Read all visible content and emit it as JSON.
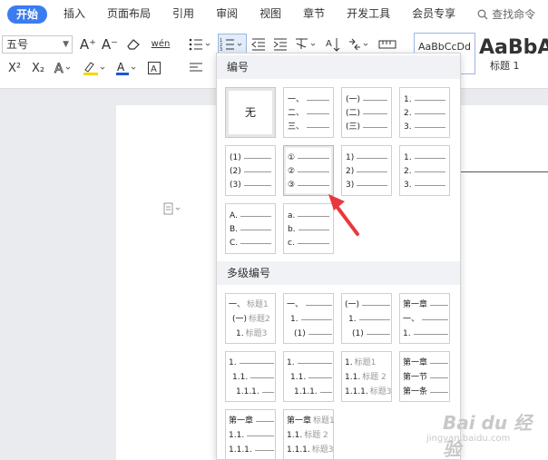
{
  "tabs": [
    {
      "label": "开始",
      "active": true
    },
    {
      "label": "插入",
      "active": false
    },
    {
      "label": "页面布局",
      "active": false
    },
    {
      "label": "引用",
      "active": false
    },
    {
      "label": "审阅",
      "active": false
    },
    {
      "label": "视图",
      "active": false
    },
    {
      "label": "章节",
      "active": false
    },
    {
      "label": "开发工具",
      "active": false
    },
    {
      "label": "会员专享",
      "active": false
    }
  ],
  "search": {
    "label": "查找命令"
  },
  "toolbar": {
    "font_size": "五号",
    "grow_font": "A⁺",
    "shrink_font": "A⁻",
    "pinyin": "wén",
    "superscript": "X²",
    "subscript": "X₂",
    "style1_sample": "AaBbCcDd",
    "style2_sample": "AaBbA",
    "style2_caption": "标题 1"
  },
  "panel": {
    "section1_title": "编号",
    "section2_title": "多级编号",
    "none_label": "无",
    "single": [
      {
        "rows": [
          "一、",
          "二、",
          "三、"
        ]
      },
      {
        "rows": [
          "(一)",
          "(二)",
          "(三)"
        ]
      },
      {
        "rows": [
          "1.",
          "2.",
          "3."
        ]
      },
      {
        "rows": [
          "(1)",
          "(2)",
          "(3)"
        ]
      },
      {
        "rows": [
          "①",
          "②",
          "③"
        ]
      },
      {
        "rows": [
          "1)",
          "2)",
          "3)"
        ]
      },
      {
        "rows": [
          "1.",
          "2.",
          "3."
        ]
      },
      {
        "rows": [
          "A.",
          "B.",
          "C."
        ]
      },
      {
        "rows": [
          "a.",
          "b.",
          "c."
        ]
      }
    ],
    "multi": [
      {
        "rows": [
          {
            "n": "一、",
            "g": "标题1"
          },
          {
            "n": "(一)",
            "g": "标题2"
          },
          {
            "n": "1.",
            "g": "标题3"
          }
        ]
      },
      {
        "rows": [
          {
            "n": "一、",
            "g": ""
          },
          {
            "n": "1.",
            "g": ""
          },
          {
            "n": "(1)",
            "g": ""
          }
        ]
      },
      {
        "rows": [
          {
            "n": "(一)",
            "g": ""
          },
          {
            "n": "1.",
            "g": ""
          },
          {
            "n": "(1)",
            "g": ""
          }
        ]
      },
      {
        "rows": [
          {
            "n": "第一章",
            "g": ""
          },
          {
            "n": "一、",
            "g": ""
          },
          {
            "n": "1.",
            "g": ""
          }
        ]
      },
      {
        "rows": [
          {
            "n": "1.",
            "g": ""
          },
          {
            "n": "1.1.",
            "g": ""
          },
          {
            "n": "1.1.1.",
            "g": ""
          }
        ]
      },
      {
        "rows": [
          {
            "n": "1.",
            "g": ""
          },
          {
            "n": "1.1.",
            "g": ""
          },
          {
            "n": "1.1.1.",
            "g": ""
          }
        ]
      },
      {
        "rows": [
          {
            "n": "1.",
            "g": "标题1"
          },
          {
            "n": "1.1.",
            "g": "标题 2"
          },
          {
            "n": "1.1.1.",
            "g": "标题3"
          }
        ]
      },
      {
        "rows": [
          {
            "n": "第一章",
            "g": ""
          },
          {
            "n": "第一节",
            "g": ""
          },
          {
            "n": "第一条",
            "g": ""
          }
        ]
      },
      {
        "rows": [
          {
            "n": "第一章",
            "g": ""
          },
          {
            "n": "1.1.",
            "g": ""
          },
          {
            "n": "1.1.1.",
            "g": ""
          }
        ]
      },
      {
        "rows": [
          {
            "n": "第一章",
            "g": "标题1"
          },
          {
            "n": "1.1.",
            "g": "标题 2"
          },
          {
            "n": "1.1.1.",
            "g": "标题3"
          }
        ]
      }
    ]
  },
  "watermark": {
    "logo": "Bai du 经验",
    "url": "jingyan.baidu.com"
  },
  "colors": {
    "accent": "#3b7cf0",
    "highlight": "#f5d800",
    "font_color": "#1a56d6",
    "arrow": "#e8383d"
  }
}
